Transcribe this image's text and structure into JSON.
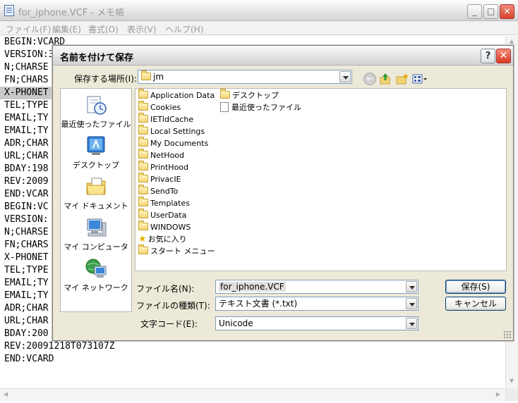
{
  "notepad": {
    "title": "for_iphone.VCF - メモ帳",
    "menu": [
      "ファイル(F)",
      "編集(E)",
      "書式(O)",
      "表示(V)",
      "ヘルプ(H)"
    ],
    "lines": [
      "BEGIN:VCARD",
      "VERSION:3",
      "N;CHARSE",
      "FN;CHARS",
      "X-PHONET",
      "TEL;TYPE",
      "EMAIL;TY",
      "EMAIL;TY",
      "ADR;CHAR",
      "URL;CHAR",
      "BDAY:198",
      "REV:2009",
      "END:VCAR",
      "BEGIN:VC",
      "VERSION:",
      "N;CHARSE",
      "FN;CHARS",
      "X-PHONET",
      "TEL;TYPE",
      "EMAIL;TY",
      "EMAIL;TY",
      "ADR;CHAR",
      "URL;CHAR",
      "BDAY:200",
      "REV:20091218T073107Z",
      "END:VCARD"
    ]
  },
  "dialog": {
    "title": "名前を付けて保存",
    "save_in_label": "保存する場所(I):",
    "save_in_value": "jm",
    "places": [
      "最近使ったファイル",
      "デスクトップ",
      "マイ ドキュメント",
      "マイ コンピュータ",
      "マイ ネットワーク"
    ],
    "files_col1": [
      "Application Data",
      "Cookies",
      "IETldCache",
      "Local Settings",
      "My Documents",
      "NetHood",
      "PrintHood",
      "PrivacIE",
      "SendTo",
      "Templates",
      "UserData",
      "WINDOWS",
      "お気に入り",
      "スタート メニュー"
    ],
    "files_col2": [
      "デスクトップ",
      "最近使ったファイル"
    ],
    "filename_label": "ファイル名(N):",
    "filename_value": "for_iphone.VCF",
    "filetype_label": "ファイルの種類(T):",
    "filetype_value": "テキスト文書 (*.txt)",
    "encoding_label": "文字コード(E):",
    "encoding_value": "Unicode",
    "save_button": "保存(S)",
    "cancel_button": "キャンセル"
  }
}
